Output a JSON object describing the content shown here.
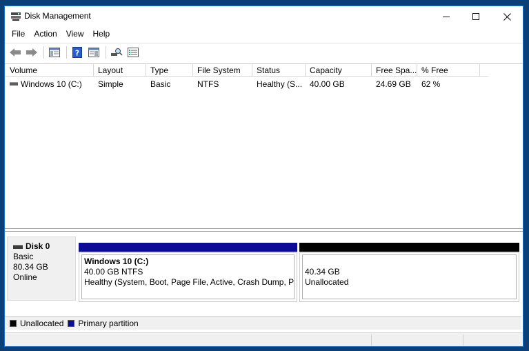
{
  "window": {
    "title": "Disk Management"
  },
  "menu": [
    "File",
    "Action",
    "View",
    "Help"
  ],
  "toolbar": {
    "buttons": [
      "back-arrow-icon",
      "forward-arrow-icon",
      "console-tree-icon",
      "help-icon",
      "properties-icon",
      "search-icon",
      "list-view-icon"
    ]
  },
  "volume_table": {
    "columns": [
      "Volume",
      "Layout",
      "Type",
      "File System",
      "Status",
      "Capacity",
      "Free Spa...",
      "% Free"
    ],
    "rows": [
      [
        "Windows 10 (C:)",
        "Simple",
        "Basic",
        "NTFS",
        "Healthy (S...",
        "40.00 GB",
        "24.69 GB",
        "62 %"
      ]
    ]
  },
  "disk": {
    "name": "Disk 0",
    "type": "Basic",
    "size": "80.34 GB",
    "state": "Online"
  },
  "partitions": [
    {
      "name": "Windows 10  (C:)",
      "size_fs": "40.00 GB NTFS",
      "status": "Healthy (System, Boot, Page File, Active, Crash Dump, Primary Partition)",
      "color": "#0b0b96"
    },
    {
      "size": "40.34 GB",
      "status": "Unallocated",
      "color": "#000000"
    }
  ],
  "legend": [
    {
      "label": "Unallocated",
      "color": "#000000"
    },
    {
      "label": "Primary partition",
      "color": "#0b0b96"
    }
  ]
}
